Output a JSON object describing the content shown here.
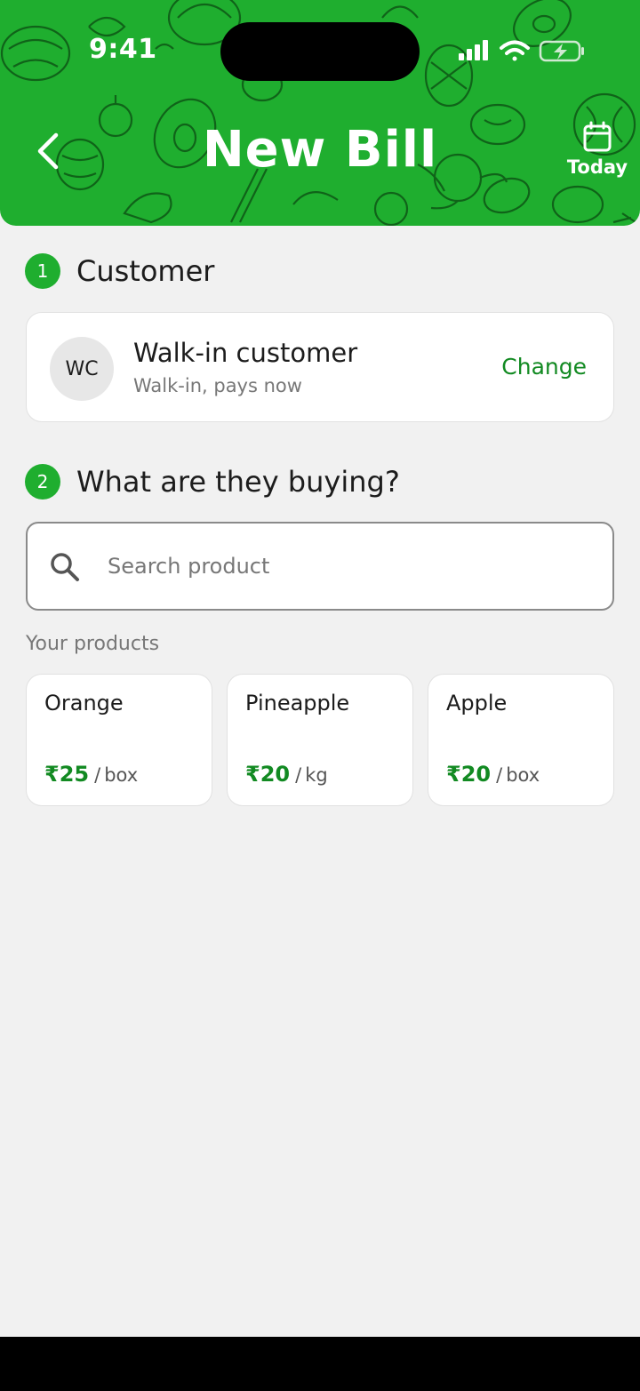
{
  "status_bar": {
    "time": "9:41"
  },
  "header": {
    "title": "New Bill",
    "today_label": "Today",
    "background_color": "#1fae2f"
  },
  "customer_section": {
    "step_number": "1",
    "heading": "Customer",
    "customer": {
      "initials": "WC",
      "name": "Walk-in customer",
      "subtitle": "Walk-in, pays now",
      "change_label": "Change"
    }
  },
  "buying_section": {
    "step_number": "2",
    "heading": "What are they buying?",
    "search": {
      "placeholder": "Search product",
      "value": ""
    },
    "products_label": "Your products",
    "products": [
      {
        "name": "Orange",
        "price": "₹25",
        "unit": "box"
      },
      {
        "name": "Pineapple",
        "price": "₹20",
        "unit": "kg"
      },
      {
        "name": "Apple",
        "price": "₹20",
        "unit": "box"
      }
    ]
  },
  "colors": {
    "accent": "#1fae2f",
    "accent_text": "#128a22",
    "background": "#f1f1f1"
  }
}
